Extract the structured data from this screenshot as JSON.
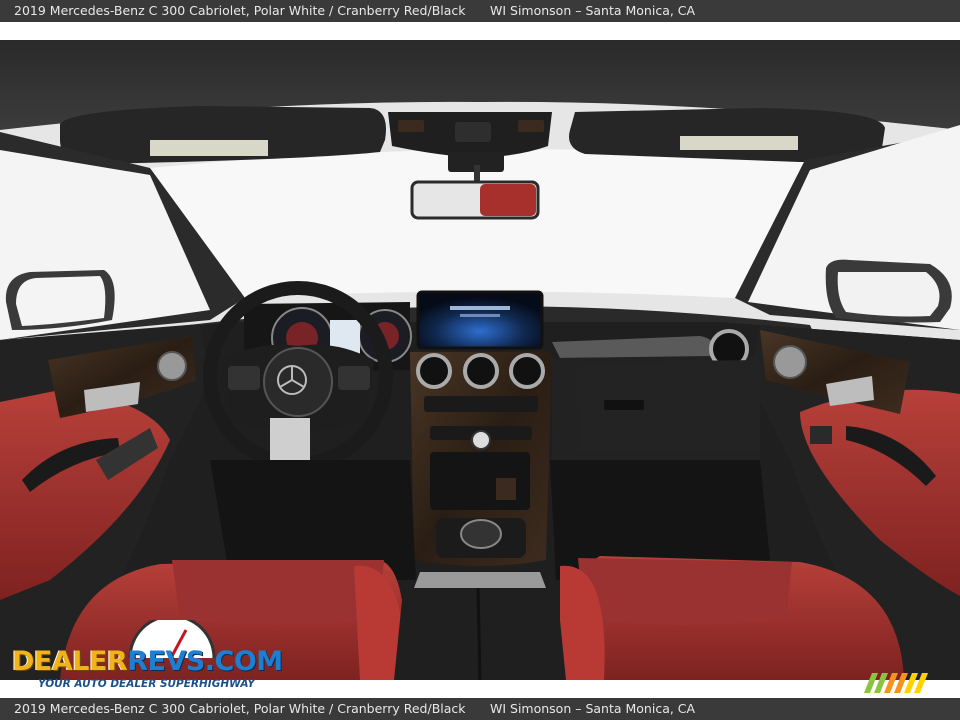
{
  "caption": {
    "vehicle": "2019 Mercedes-Benz C 300 Cabriolet,  Polar White / Cranberry Red/Black",
    "dealer": "WI Simonson – Santa Monica, CA"
  },
  "watermark": {
    "brand_part1": "DEALER",
    "brand_part2": "REVS",
    "brand_part3": ".COM",
    "tagline": "YOUR AUTO DEALER SUPERHIGHWAY"
  },
  "colors": {
    "caption_bar": "#3a3a3a",
    "upholstery": "#a8302c",
    "trim": "#1c1c1c",
    "wood": "#3a2a1e"
  }
}
